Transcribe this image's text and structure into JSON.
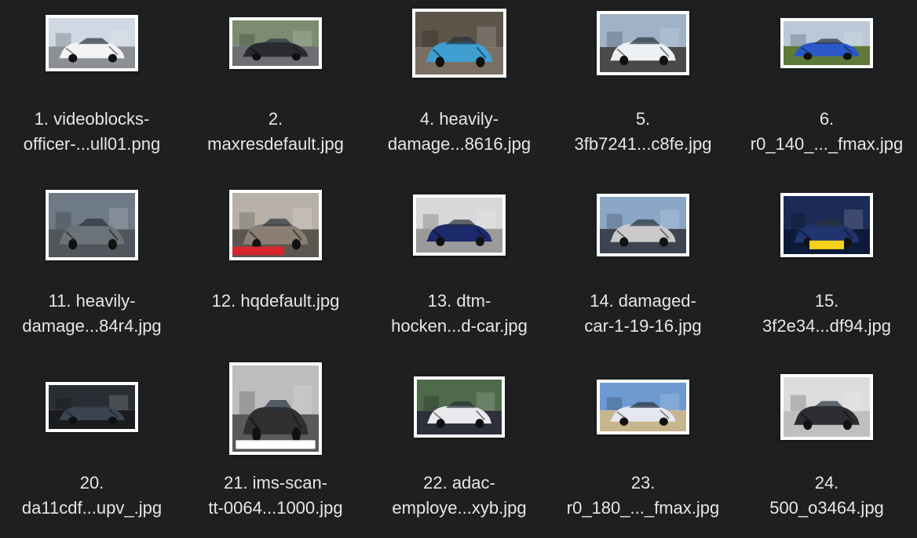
{
  "files": [
    {
      "line1": "1. videoblocks-",
      "line2": "officer-...ull01.png",
      "scene": "police",
      "sky": "#cfd8e3",
      "ground": "#8c8f93",
      "car": "#f2f3f5"
    },
    {
      "line1": "2.",
      "line2": "maxresdefault.jpg",
      "scene": "road",
      "sky": "#7b8c70",
      "ground": "#6d6f72",
      "car": "#2a2b2e"
    },
    {
      "line1": "4. heavily-",
      "line2": "damage...8616.jpg",
      "scene": "rust",
      "sky": "#5c554a",
      "ground": "#7a6f62",
      "car": "#3f9fd1"
    },
    {
      "line1": "5.",
      "line2": "3fb7241...c8fe.jpg",
      "scene": "beach",
      "sky": "#9fb2c8",
      "ground": "#4a4a4a",
      "car": "#eef1f4"
    },
    {
      "line1": "6.",
      "line2": "r0_140_..._fmax.jpg",
      "scene": "house",
      "sky": "#b9c9d8",
      "ground": "#5e7a3a",
      "car": "#2a58c9"
    },
    {
      "line1": "11. heavily-",
      "line2": "damage...84r4.jpg",
      "scene": "wreck",
      "sky": "#6e7a85",
      "ground": "#50565c",
      "car": "#6c7378"
    },
    {
      "line1": "12. hqdefault.jpg",
      "line2": "",
      "scene": "news",
      "sky": "#b8b1a8",
      "ground": "#5b5650",
      "car": "#8a7f72"
    },
    {
      "line1": "13. dtm-",
      "line2": "hocken...d-car.jpg",
      "scene": "race",
      "sky": "#d8d8d8",
      "ground": "#9a9a9a",
      "car": "#1d2a6b"
    },
    {
      "line1": "14. damaged-",
      "line2": "car-1-19-16.jpg",
      "scene": "street",
      "sky": "#8aa7c7",
      "ground": "#3d4450",
      "car": "#c9c9c9"
    },
    {
      "line1": "15.",
      "line2": "3f2e34...df94.jpg",
      "scene": "plate",
      "sky": "#1c2b55",
      "ground": "#0e1a3a",
      "car": "#20346e"
    },
    {
      "line1": "20.",
      "line2": "da11cdf...upv_.jpg",
      "scene": "toyota",
      "sky": "#2a2d33",
      "ground": "#1a1c20",
      "car": "#3b4552"
    },
    {
      "line1": "21. ims-scan-",
      "line2": "tt-0064...1000.jpg",
      "scene": "photo",
      "sky": "#bdbdbd",
      "ground": "#5a5a5a",
      "car": "#303030"
    },
    {
      "line1": "22. adac-",
      "line2": "employe...xyb.jpg",
      "scene": "bus",
      "sky": "#4e6a4a",
      "ground": "#2d2f3a",
      "car": "#e9e9ee"
    },
    {
      "line1": "23.",
      "line2": "r0_180_..._fmax.jpg",
      "scene": "scene",
      "sky": "#6e9ad2",
      "ground": "#c7b58e",
      "car": "#e4e7ee"
    },
    {
      "line1": "24.",
      "line2": "500_o3464.jpg",
      "scene": "sedan",
      "sky": "#dcdcdc",
      "ground": "#bfbfbf",
      "car": "#2b2d31"
    }
  ]
}
